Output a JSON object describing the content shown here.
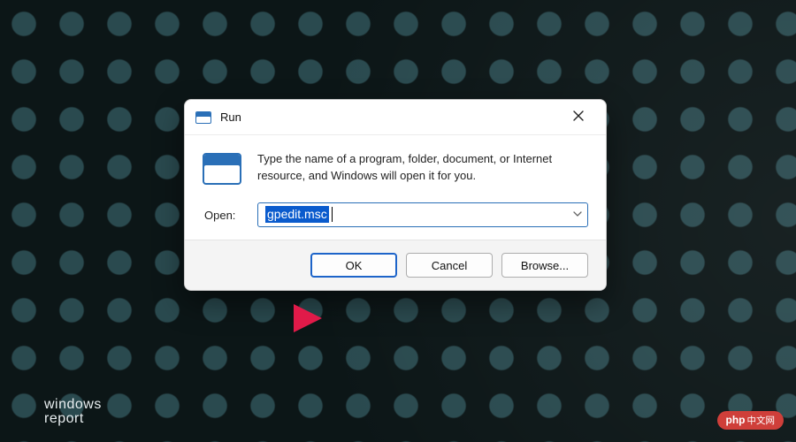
{
  "dialog": {
    "title": "Run",
    "instruction": "Type the name of a program, folder, document, or Internet resource, and Windows will open it for you.",
    "open_label": "Open:",
    "input_value": "gpedit.msc",
    "buttons": {
      "ok": "OK",
      "cancel": "Cancel",
      "browse": "Browse..."
    }
  },
  "watermarks": {
    "line1": "windows",
    "line2": "report",
    "badge_main": "php",
    "badge_suffix": "中文网"
  },
  "colors": {
    "accent": "#1d64c9",
    "selection": "#0a5bcd",
    "arrow": "#c1123a"
  }
}
